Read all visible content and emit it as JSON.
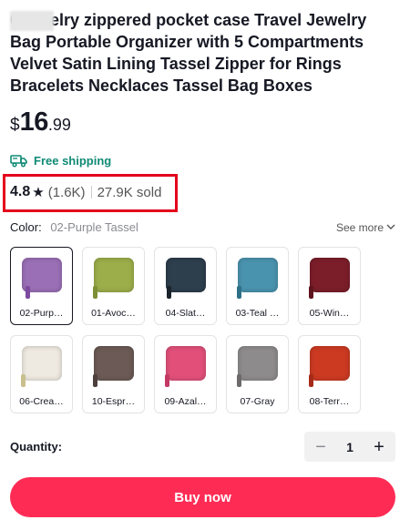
{
  "product": {
    "title": "0 jewelry zippered pocket case Travel Jewelry Bag Portable Organizer with 5 Compartments Velvet Satin Lining Tassel Zipper for Rings Bracelets Necklaces Tassel Bag Boxes",
    "price_currency": "$",
    "price_integer": "16",
    "price_decimal": ".99"
  },
  "shipping": {
    "label": "Free shipping",
    "icon": "truck-icon",
    "color": "#0f8a75"
  },
  "rating": {
    "score": "4.8",
    "star": "★",
    "reviews": "(1.6K)",
    "sold": "27.9K sold",
    "highlight_color": "#e4001b"
  },
  "color": {
    "label": "Color:",
    "selected_value": "02-Purple Tassel",
    "see_more": "See more",
    "options": [
      {
        "label": "02-Purp…",
        "swatch": "#9a6fb6",
        "tassel": "#7e4aa0",
        "selected": true
      },
      {
        "label": "01-Avoc…",
        "swatch": "#9cae4a",
        "tassel": "#7e8f35",
        "selected": false
      },
      {
        "label": "04-Slat…",
        "swatch": "#2d3e4d",
        "tassel": "#1a232c",
        "selected": false
      },
      {
        "label": "03-Teal …",
        "swatch": "#4a93ae",
        "tassel": "#2e7088",
        "selected": false
      },
      {
        "label": "05-Win…",
        "swatch": "#7b1e2a",
        "tassel": "#5e141e",
        "selected": false
      },
      {
        "label": "06-Crea…",
        "swatch": "#efeae1",
        "tassel": "#c7c08c",
        "selected": false
      },
      {
        "label": "10-Espr…",
        "swatch": "#6b5a55",
        "tassel": "#4d3f3b",
        "selected": false
      },
      {
        "label": "09-Azal…",
        "swatch": "#e2507a",
        "tassel": "#c43963",
        "selected": false
      },
      {
        "label": "07-Gray",
        "swatch": "#8e8b8c",
        "tassel": "#6c6a6b",
        "selected": false
      },
      {
        "label": "08-Terr…",
        "swatch": "#cc3a22",
        "tassel": "#a52b18",
        "selected": false
      }
    ]
  },
  "quantity": {
    "label": "Quantity:",
    "value": "1",
    "minus": "−",
    "plus": "+"
  },
  "buy_button": {
    "label": "Buy now",
    "color": "#fe2c55"
  }
}
